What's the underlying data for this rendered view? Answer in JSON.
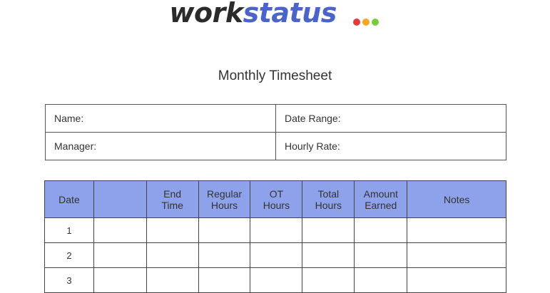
{
  "logo": {
    "part1": "work",
    "part2": "status",
    "dot_colors": [
      "#e23b3b",
      "#f5a623",
      "#7ac943"
    ]
  },
  "title": "Monthly Timesheet",
  "info": {
    "name_label": "Name:",
    "date_range_label": "Date Range:",
    "manager_label": "Manager:",
    "hourly_rate_label": "Hourly Rate:"
  },
  "table": {
    "headers": [
      "Date",
      "",
      "End\nTime",
      "Regular\nHours",
      "OT\nHours",
      "Total\nHours",
      "Amount\nEarned",
      "Notes"
    ],
    "rows": [
      "1",
      "2",
      "3"
    ]
  },
  "colors": {
    "header_bg": "#8ea2eb",
    "brand_blue": "#4a64c7"
  }
}
